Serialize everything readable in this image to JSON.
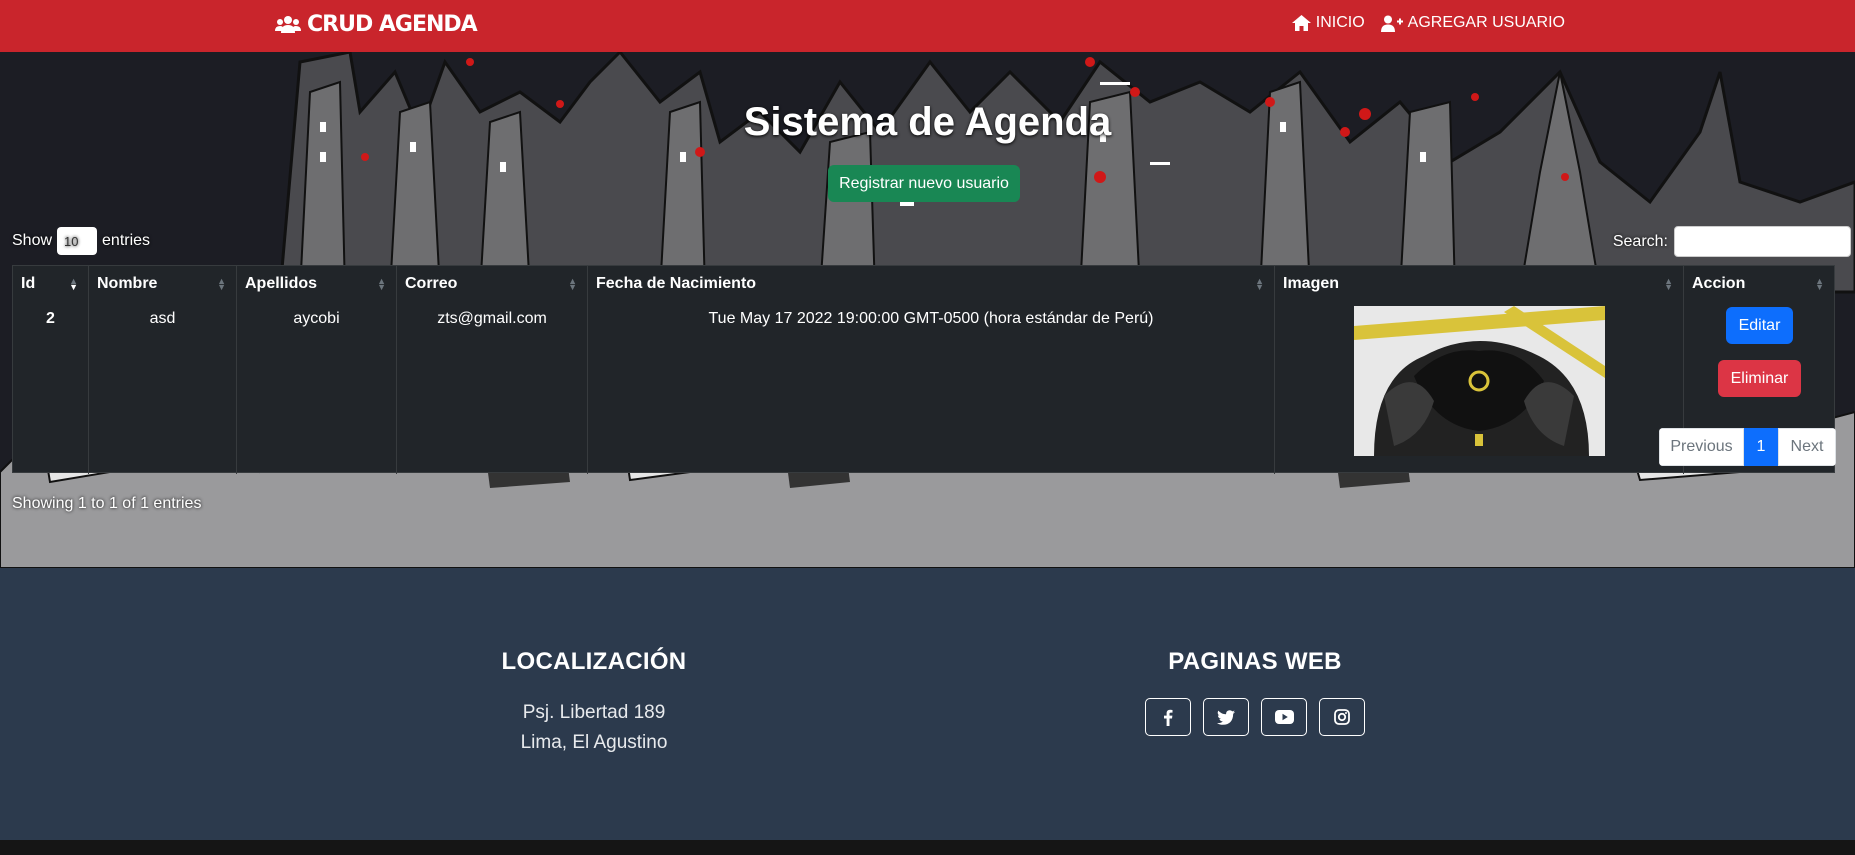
{
  "navbar": {
    "brand": "CRUD AGENDA",
    "brand_icon": "users-icon",
    "links": [
      {
        "label": "INICIO",
        "icon": "home-icon"
      },
      {
        "label": "AGREGAR USUARIO",
        "icon": "user-plus-icon"
      }
    ],
    "color": "#c9252c"
  },
  "hero": {
    "title": "Sistema de Agenda",
    "register_button": "Registrar nuevo usuario"
  },
  "datatable": {
    "show_label": "Show",
    "entries_value": "10",
    "entries_label": "entries",
    "search_label": "Search:",
    "search_value": "",
    "columns": [
      "Id",
      "Nombre",
      "Apellidos",
      "Correo",
      "Fecha de Nacimiento",
      "Imagen",
      "Accion"
    ],
    "rows": [
      {
        "id": "2",
        "nombre": "asd",
        "apellidos": "aycobi",
        "correo": "zts@gmail.com",
        "fecha": "Tue May 17 2022 19:00:00 GMT-0500 (hora estándar de Perú)",
        "edit_label": "Editar",
        "delete_label": "Eliminar"
      }
    ],
    "info": "Showing 1 to 1 of 1 entries",
    "pagination": {
      "previous": "Previous",
      "current": "1",
      "next": "Next"
    }
  },
  "footer": {
    "location_title": "LOCALIZACIÓN",
    "address_line1": "Psj. Libertad 189",
    "address_line2": "Lima, El Agustino",
    "web_title": "PAGINAS WEB",
    "social": [
      "facebook-icon",
      "twitter-icon",
      "youtube-icon",
      "instagram-icon"
    ],
    "color": "#2c3a4d"
  }
}
